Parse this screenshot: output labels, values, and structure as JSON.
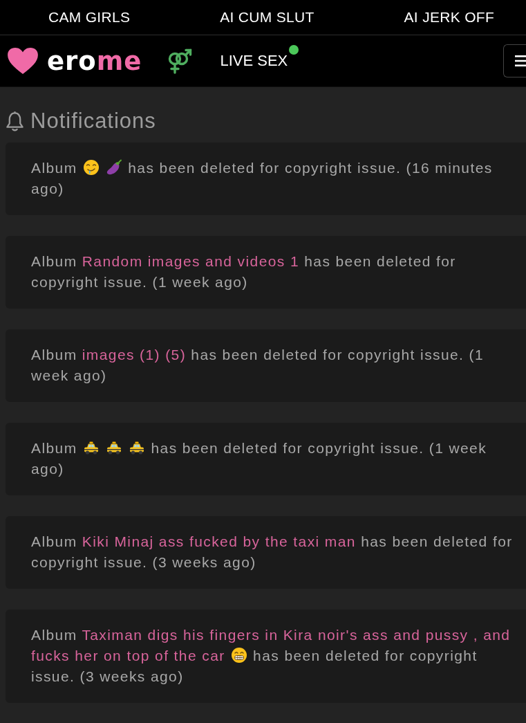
{
  "top_links": [
    {
      "label": "CAM GIRLS"
    },
    {
      "label": "AI CUM SLUT"
    },
    {
      "label": "AI JERK OFF"
    }
  ],
  "navbar": {
    "logo": {
      "text": "ero",
      "accent_text": "me"
    },
    "live_link": {
      "label": "LIVE SEX",
      "online": true
    }
  },
  "page": {
    "title": "Notifications"
  },
  "notifications": [
    {
      "prefix": "Album",
      "title": [
        {
          "kind": "drooling_face"
        },
        {
          "kind": "eggplant"
        }
      ],
      "message": "has been deleted for copyright issue. (16 minutes ago)"
    },
    {
      "prefix": "Album",
      "title": [
        {
          "kind": "text",
          "text": "Random images and videos 1"
        }
      ],
      "message": "has been deleted for copyright issue. (1 week ago)"
    },
    {
      "prefix": "Album",
      "title": [
        {
          "kind": "text",
          "text": "images (1) (5)"
        }
      ],
      "message": "has been deleted for copyright issue. (1 week ago)"
    },
    {
      "prefix": "Album",
      "title": [
        {
          "kind": "taxi"
        },
        {
          "kind": "taxi"
        },
        {
          "kind": "taxi"
        }
      ],
      "message": "has been deleted for copyright issue. (1 week ago)"
    },
    {
      "prefix": "Album",
      "title": [
        {
          "kind": "text",
          "text": "Kiki Minaj ass fucked by the taxi man"
        }
      ],
      "message": "has been deleted for copyright issue. (3 weeks ago)"
    },
    {
      "prefix": "Album",
      "title": [
        {
          "kind": "text",
          "text": "Taximan digs his fingers in Kira noir's ass and pussy , and"
        },
        {
          "kind": "text",
          "text": "fucks her on top of the car"
        },
        {
          "kind": "grinning_face"
        }
      ],
      "message": "has been deleted for copyright issue. (3 weeks ago)"
    }
  ]
}
